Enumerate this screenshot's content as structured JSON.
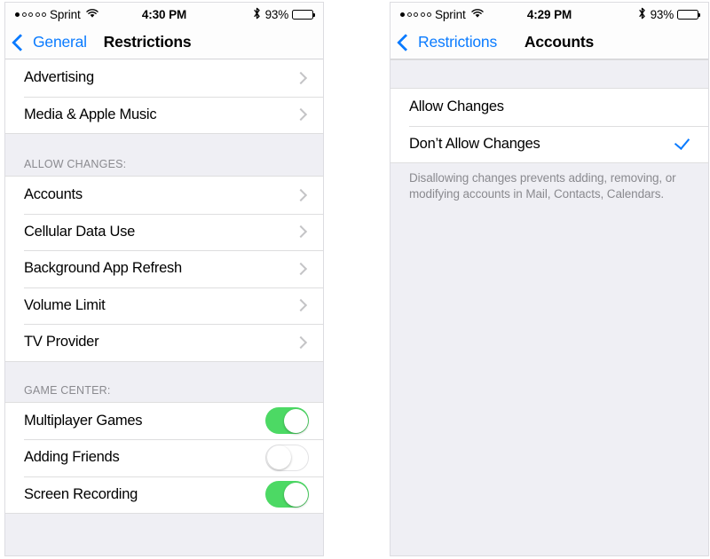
{
  "left_screen": {
    "status_bar": {
      "carrier": "Sprint",
      "signal_dots": [
        true,
        false,
        false,
        false,
        false
      ],
      "wifi_icon": "wifi-icon",
      "time": "4:30 PM",
      "bluetooth_icon": "bluetooth-icon",
      "battery_percent": "93%",
      "battery_icon": "battery-icon"
    },
    "nav": {
      "back_label": "General",
      "back_icon": "chevron-left-icon",
      "title": "Restrictions"
    },
    "group1": [
      {
        "label": "Advertising",
        "accessory": "chevron-right-icon"
      },
      {
        "label": "Media & Apple Music",
        "accessory": "chevron-right-icon"
      }
    ],
    "section2_header": "ALLOW CHANGES:",
    "group2": [
      {
        "label": "Accounts",
        "accessory": "chevron-right-icon"
      },
      {
        "label": "Cellular Data Use",
        "accessory": "chevron-right-icon"
      },
      {
        "label": "Background App Refresh",
        "accessory": "chevron-right-icon"
      },
      {
        "label": "Volume Limit",
        "accessory": "chevron-right-icon"
      },
      {
        "label": "TV Provider",
        "accessory": "chevron-right-icon"
      }
    ],
    "section3_header": "GAME CENTER:",
    "group3": [
      {
        "label": "Multiplayer Games",
        "toggle": "on"
      },
      {
        "label": "Adding Friends",
        "toggle": "off"
      },
      {
        "label": "Screen Recording",
        "toggle": "on"
      }
    ]
  },
  "right_screen": {
    "status_bar": {
      "carrier": "Sprint",
      "signal_dots": [
        true,
        false,
        false,
        false,
        false
      ],
      "wifi_icon": "wifi-icon",
      "time": "4:29 PM",
      "bluetooth_icon": "bluetooth-icon",
      "battery_percent": "93%",
      "battery_icon": "battery-icon"
    },
    "nav": {
      "back_label": "Restrictions",
      "back_icon": "chevron-left-icon",
      "title": "Accounts"
    },
    "options": [
      {
        "label": "Allow Changes",
        "selected": false
      },
      {
        "label": "Don’t Allow Changes",
        "selected": true
      }
    ],
    "footnote": "Disallowing changes prevents adding, removing, or modifying accounts in Mail, Contacts, Calendars."
  },
  "colors": {
    "accent_blue": "#0a7bff",
    "toggle_green": "#4cd964",
    "group_background": "#ffffff",
    "page_background": "#efeff4",
    "secondary_text": "#8a8a8f",
    "separator": "#dededf"
  }
}
